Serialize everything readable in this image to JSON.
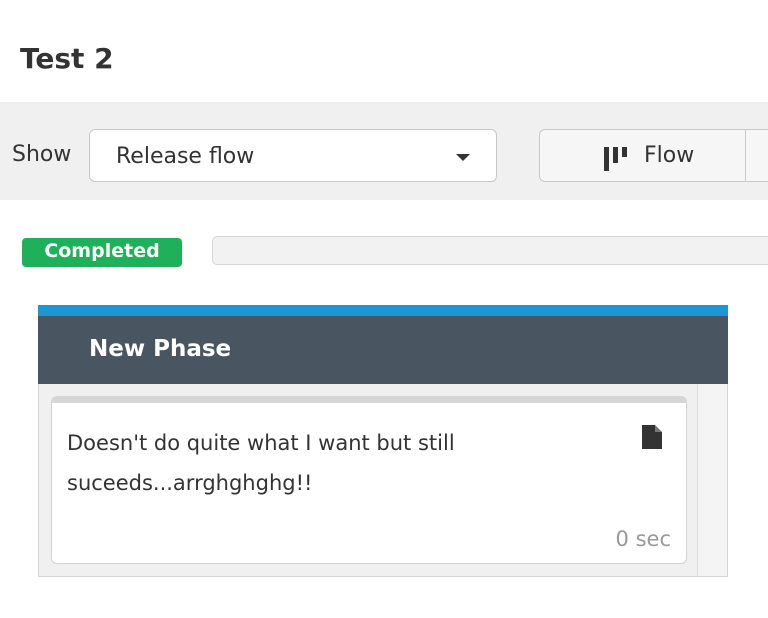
{
  "page": {
    "title": "Test 2"
  },
  "toolbar": {
    "show_label": "Show",
    "view_select": {
      "selected": "Release flow"
    },
    "view_buttons": [
      {
        "label": "Flow",
        "icon": "flow-board-icon",
        "active": true
      }
    ]
  },
  "status": {
    "badge": "Completed",
    "badge_color": "#1fb159"
  },
  "phase": {
    "title": "New Phase",
    "accent_color": "#1d96d1",
    "header_color": "#4a5562",
    "tasks": [
      {
        "title": "Doesn't do quite what I want but still suceeds...arrghghghg!!",
        "icon": "document-icon",
        "duration": "0 sec"
      }
    ]
  }
}
